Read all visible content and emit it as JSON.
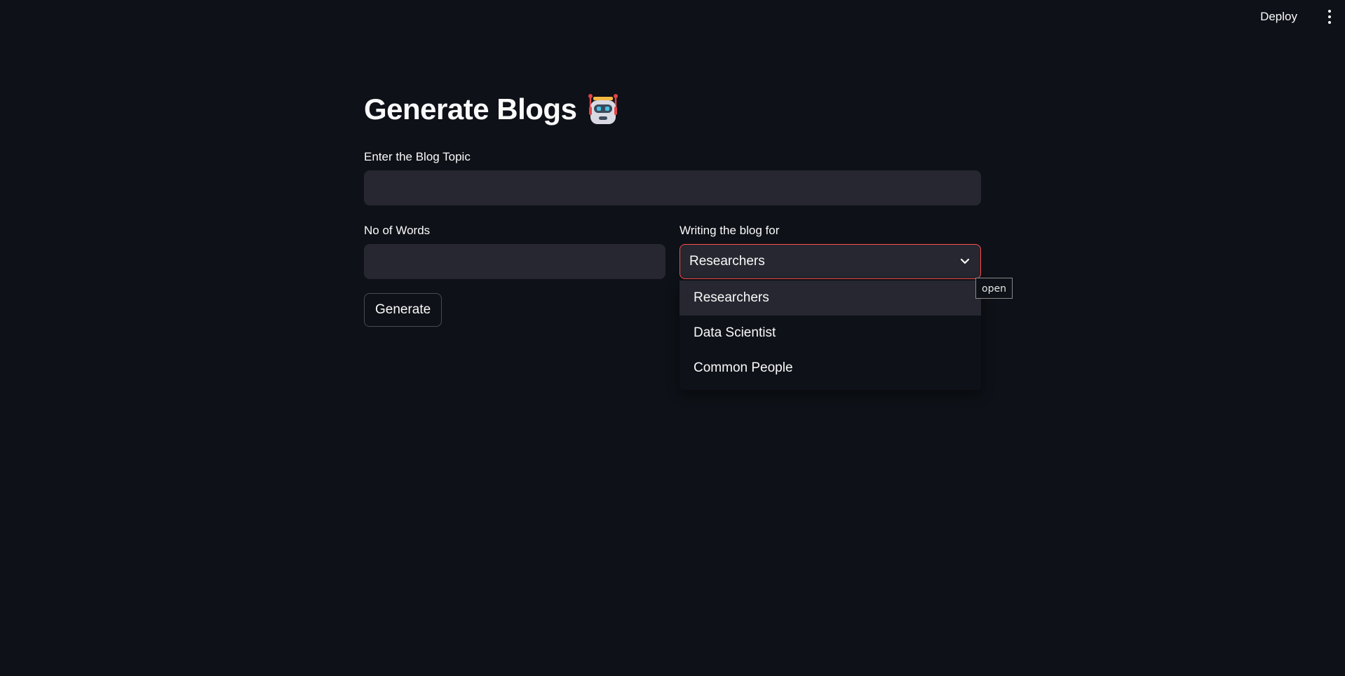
{
  "header": {
    "deploy_label": "Deploy",
    "menu_icon": "kebab-menu-icon"
  },
  "page": {
    "title": "Generate Blogs",
    "title_emoji": "robot-icon"
  },
  "form": {
    "topic_label": "Enter the Blog Topic",
    "topic_value": "",
    "words_label": "No of Words",
    "words_value": "",
    "audience_label": "Writing the blog for",
    "audience_selected": "Researchers",
    "audience_options": [
      "Researchers",
      "Data Scientist",
      "Common People"
    ],
    "generate_label": "Generate"
  },
  "tooltip": {
    "text": "open"
  },
  "colors": {
    "background": "#0e1117",
    "input_bg": "#262730",
    "focus_border": "#ff4b4b",
    "text": "#fafafa"
  }
}
